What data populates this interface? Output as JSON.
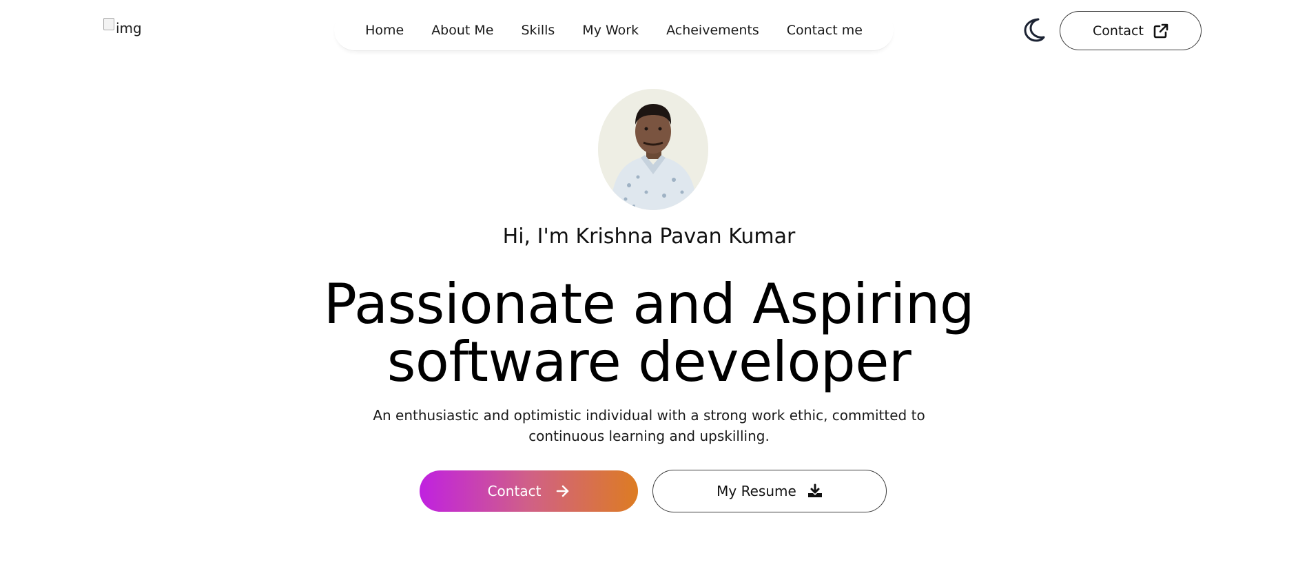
{
  "header": {
    "logo_alt": "img",
    "nav": [
      {
        "label": "Home"
      },
      {
        "label": "About Me"
      },
      {
        "label": "Skills"
      },
      {
        "label": "My Work"
      },
      {
        "label": "Acheivements"
      },
      {
        "label": "Contact me"
      }
    ],
    "theme_icon": "moon-icon",
    "contact_button": {
      "label": "Contact",
      "icon": "external-link-icon"
    }
  },
  "hero": {
    "avatar_icon": "profile-photo",
    "greeting": "Hi, I'm Krishna Pavan Kumar",
    "headline_line1": "Passionate and Aspiring",
    "headline_line2": "software developer",
    "subtitle": "An enthusiastic and optimistic individual with a strong work ethic, committed to continuous learning and upskilling.",
    "contact_button": {
      "label": "Contact",
      "icon": "arrow-right-icon"
    },
    "resume_button": {
      "label": "My Resume",
      "icon": "download-icon"
    }
  },
  "colors": {
    "gradient_start": "#c021e0",
    "gradient_mid": "#d06087",
    "gradient_end": "#dd7c22",
    "text": "#111111",
    "background": "#ffffff"
  }
}
